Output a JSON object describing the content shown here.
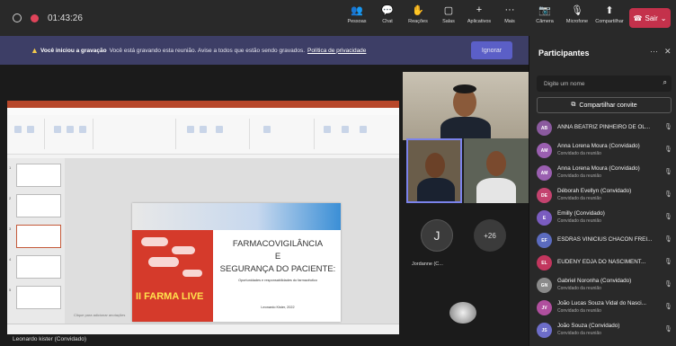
{
  "topbar": {
    "timer": "01:43:26",
    "tools": [
      {
        "icon": "people-icon",
        "glyph": "👥",
        "label": "Pessoas"
      },
      {
        "icon": "chat-icon",
        "glyph": "💬",
        "label": "Chat"
      },
      {
        "icon": "reactions-icon",
        "glyph": "✋",
        "label": "Reações"
      },
      {
        "icon": "rooms-icon",
        "glyph": "▢",
        "label": "Salas"
      },
      {
        "icon": "apps-icon",
        "glyph": "+",
        "label": "Aplicativos"
      },
      {
        "icon": "more-icon",
        "glyph": "···",
        "label": "Mais"
      }
    ],
    "devices": [
      {
        "icon": "camera-icon",
        "glyph": "📷",
        "label": "Câmera"
      },
      {
        "icon": "microphone-icon",
        "glyph": "🎙",
        "label": "Microfone"
      },
      {
        "icon": "share-icon",
        "glyph": "⬆",
        "label": "Compartilhar"
      }
    ],
    "leave_label": "Sair"
  },
  "banner": {
    "bold": "Você iniciou a gravação",
    "text": "Você está gravando esta reunião. Avise a todos que estão sendo gravados.",
    "link": "Política de privacidade",
    "ignore_label": "Ignorar"
  },
  "slide": {
    "line1": "FARMACOVIGILÂNCIA",
    "line2": "E",
    "line3": "SEGURANÇA DO PACIENTE:",
    "subtitle": "Oportunidades e responsabilidades do farmacêutico",
    "author": "Leonardo Kister, 2022",
    "promo_title": "II FARMA LIVE",
    "notes_hint": "Clique para adicionar anotações"
  },
  "stage": {
    "presenter_caption": "Leonardo kister (Convidado)",
    "tile_j_initial": "J",
    "tile_j_name": "Jordanne (C...",
    "more_count": "+26"
  },
  "panel": {
    "title": "Participantes",
    "search_placeholder": "Digite um nome",
    "share_invite": "Compartilhar convite",
    "participants": [
      {
        "initials": "AB",
        "name": "ANNA BEATRIZ PINHEIRO DE OL...",
        "sub": "",
        "color": "#8b5a9f"
      },
      {
        "initials": "AM",
        "name": "Anna Lorena Moura (Convidado)",
        "sub": "Convidado da reunião",
        "color": "#9a5fb0"
      },
      {
        "initials": "AM",
        "name": "Anna Lorena Moura (Convidado)",
        "sub": "Convidado da reunião",
        "color": "#9a5fb0"
      },
      {
        "initials": "DE",
        "name": "Déborah Evellyn (Convidado)",
        "sub": "Convidado da reunião",
        "color": "#c4436f"
      },
      {
        "initials": "E",
        "name": "Emilly (Convidado)",
        "sub": "Convidado da reunião",
        "color": "#7a5cc0"
      },
      {
        "initials": "EF",
        "name": "ESDRAS VINICIUS CHACON FREI...",
        "sub": "",
        "color": "#5b6bbf"
      },
      {
        "initials": "EL",
        "name": "EUDENY EDJA DO NASCIMENT...",
        "sub": "",
        "color": "#c2365e"
      },
      {
        "initials": "GN",
        "name": "Gabriel Noronha (Convidado)",
        "sub": "Convidado da reunião",
        "color": "#8a8a8a"
      },
      {
        "initials": "JV",
        "name": "João Lucas Souza Vidal do Nasci...",
        "sub": "Convidado da reunião",
        "color": "#b04f9e"
      },
      {
        "initials": "JS",
        "name": "João Souza (Convidado)",
        "sub": "Convidado da reunião",
        "color": "#6d6dc9"
      }
    ]
  }
}
